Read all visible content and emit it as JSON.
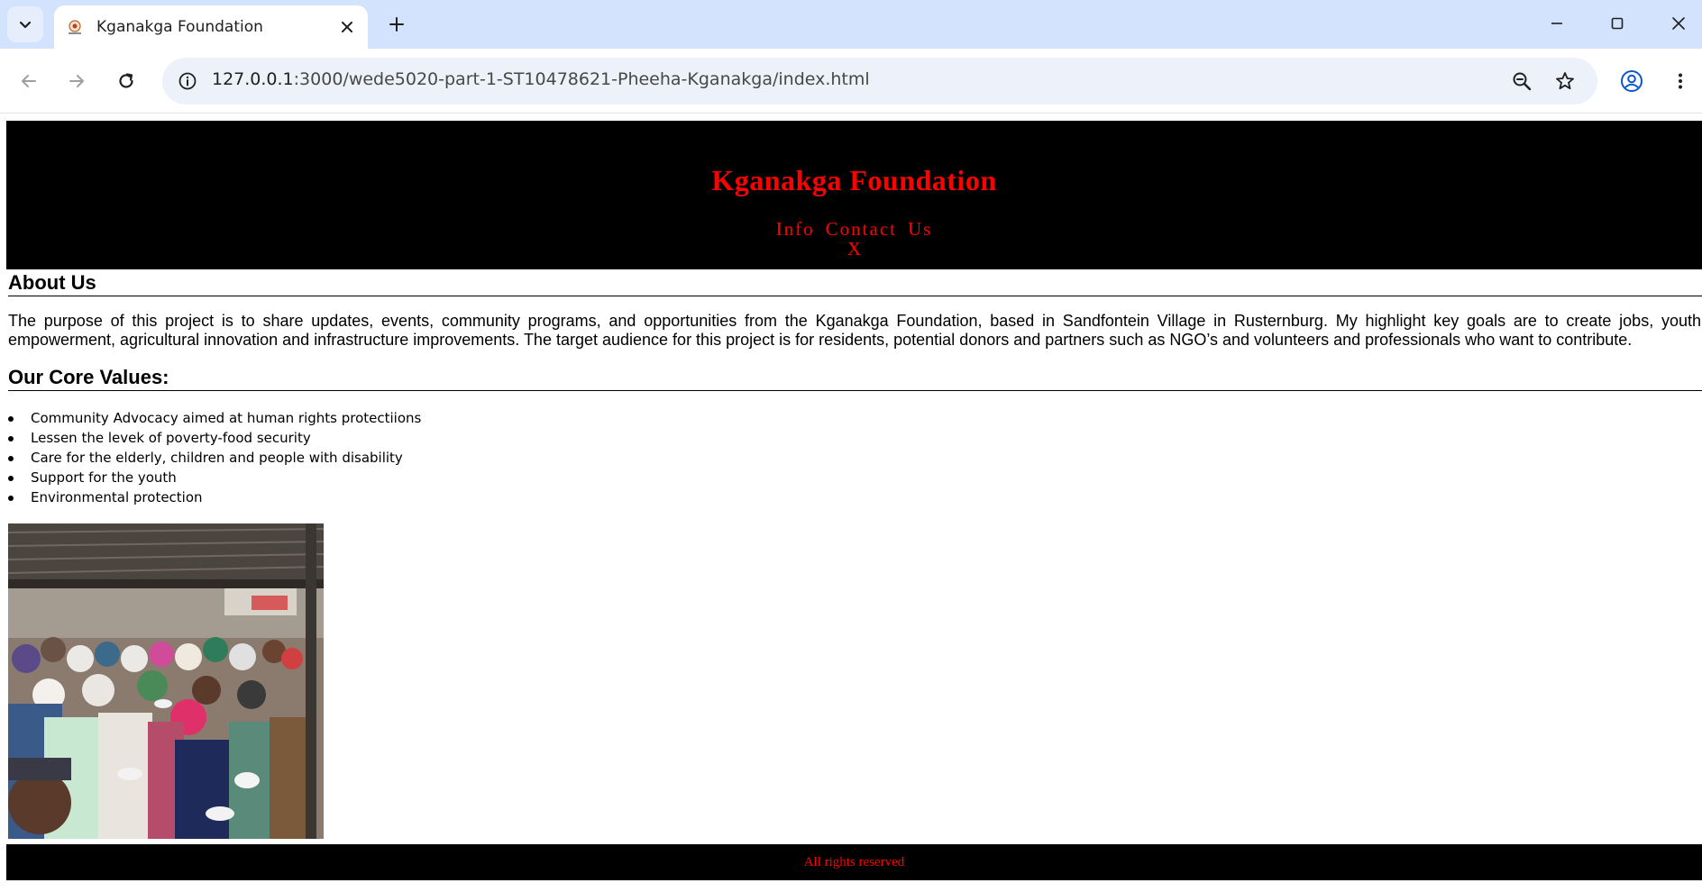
{
  "browser": {
    "tab_title": "Kganakga Foundation",
    "url_host": "127.0.0.1",
    "url_path": ":3000/wede5020-part-1-ST10478621-Pheeha-Kganakga/index.html"
  },
  "header": {
    "title": "Kganakga Foundation",
    "nav": [
      "Info",
      "Contact",
      "Us"
    ],
    "close_label": "X"
  },
  "about": {
    "heading": "About Us",
    "text": "The purpose of this project is to share updates, events, community programs, and opportunities from the Kganakga Foundation, based in Sandfontein Village in Rusternburg. My highlight key goals are to create jobs, youth empowerment, agricultural innovation and infrastructure improvements. The target audience for this project is for residents, potential donors and partners such as NGO’s and volunteers and professionals who want to contribute."
  },
  "values": {
    "heading": "Our Core Values:",
    "items": [
      "Community Advocacy aimed at human rights protectiions",
      "Lessen the levek of poverty-food security",
      "Care for the elderly, children and people with disability",
      "Support for the youth",
      "Environmental protection"
    ]
  },
  "footer": {
    "text": "All rights reserved"
  },
  "colors": {
    "accent": "#ff0000",
    "header_bg": "#000000",
    "tabstrip_bg": "#d3e3fd"
  }
}
